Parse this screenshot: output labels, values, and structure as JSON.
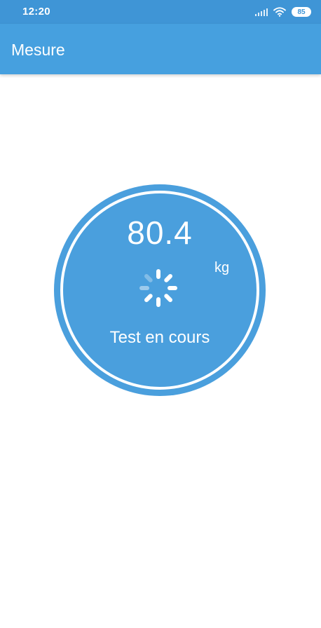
{
  "status_bar": {
    "time": "12:20",
    "battery": "85",
    "icons": [
      "signal-icon",
      "wifi-icon",
      "battery-icon"
    ]
  },
  "app_bar": {
    "title": "Mesure"
  },
  "measurement": {
    "value": "80.4",
    "unit": "kg",
    "status": "Test en cours",
    "icon": "spinner-icon"
  },
  "colors": {
    "primary": "#46a0df",
    "status_bar": "#3f95d6",
    "gauge": "#4a9fdd",
    "text_on_primary": "#ffffff"
  }
}
